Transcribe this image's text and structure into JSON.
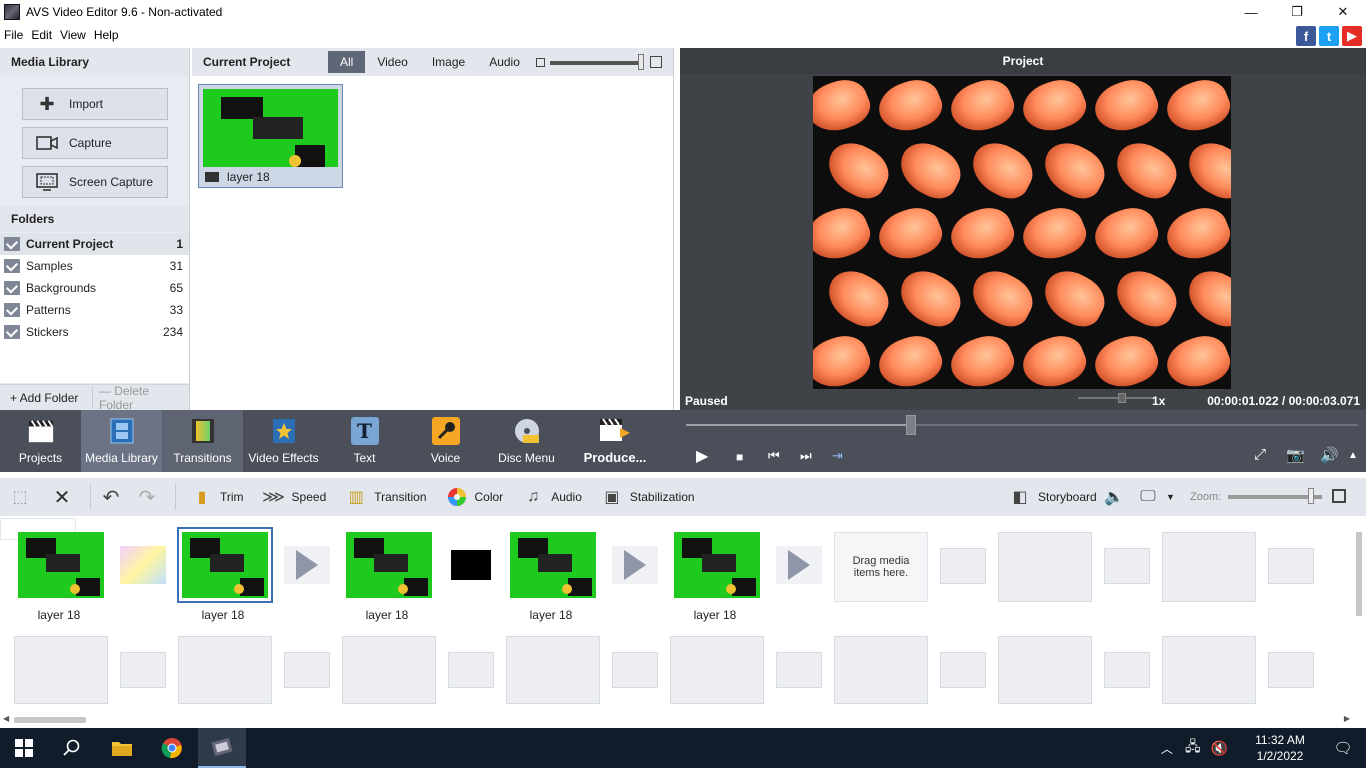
{
  "window": {
    "title": "AVS Video Editor 9.6 - Non-activated",
    "minimize": "—",
    "maximize": "❐",
    "close": "✕"
  },
  "menu": [
    "File",
    "Edit",
    "View",
    "Help"
  ],
  "social": {
    "facebook": "f",
    "twitter": "t",
    "youtube": "▶"
  },
  "media_library": {
    "title": "Media Library",
    "buttons": [
      {
        "label": "Import",
        "icon": "plus-icon"
      },
      {
        "label": "Capture",
        "icon": "camera-icon"
      },
      {
        "label": "Screen Capture",
        "icon": "screen-capture-icon"
      }
    ],
    "folders_title": "Folders",
    "folders": [
      {
        "name": "Current Project",
        "count": "1",
        "selected": true
      },
      {
        "name": "Samples",
        "count": "31"
      },
      {
        "name": "Backgrounds",
        "count": "65"
      },
      {
        "name": "Patterns",
        "count": "33"
      },
      {
        "name": "Stickers",
        "count": "234"
      }
    ],
    "add_folder": "+ Add Folder",
    "delete_folder": "— Delete Folder"
  },
  "project_media": {
    "title": "Current Project",
    "filters": [
      "All",
      "Video",
      "Image",
      "Audio"
    ],
    "active_filter": "All",
    "items": [
      {
        "label": "layer 18"
      }
    ]
  },
  "preview": {
    "title": "Project",
    "status": "Paused",
    "speed": "1x",
    "current_time": "00:00:01.022",
    "separator": "/",
    "total_time": "00:00:03.071"
  },
  "main_toolbar": [
    {
      "label": "Projects",
      "icon": "clapperboard-icon"
    },
    {
      "label": "Media Library",
      "icon": "film-strip-icon",
      "active": true
    },
    {
      "label": "Transitions",
      "icon": "transitions-icon"
    },
    {
      "label": "Video Effects",
      "icon": "star-icon"
    },
    {
      "label": "Text",
      "icon": "text-icon"
    },
    {
      "label": "Voice",
      "icon": "microphone-icon"
    },
    {
      "label": "Disc Menu",
      "icon": "disc-icon"
    },
    {
      "label": "Produce...",
      "icon": "produce-icon"
    }
  ],
  "timeline_toolbar": {
    "items": [
      "Trim",
      "Speed",
      "Transition",
      "Color",
      "Audio",
      "Stabilization"
    ],
    "view_mode": "Storyboard",
    "zoom_label": "Zoom:"
  },
  "storyboard": {
    "clips": [
      "layer 18",
      "layer 18",
      "layer 18",
      "layer 18",
      "layer 18"
    ],
    "drag_hint": "Drag media items here."
  },
  "taskbar": {
    "time": "11:32 AM",
    "date": "1/2/2022"
  },
  "colors": {
    "toolbar_dark": "#4a4f5a",
    "panel_bg": "#e3e6ed",
    "selection": "#3d6fb8",
    "thumb_green": "#1fca1f"
  }
}
